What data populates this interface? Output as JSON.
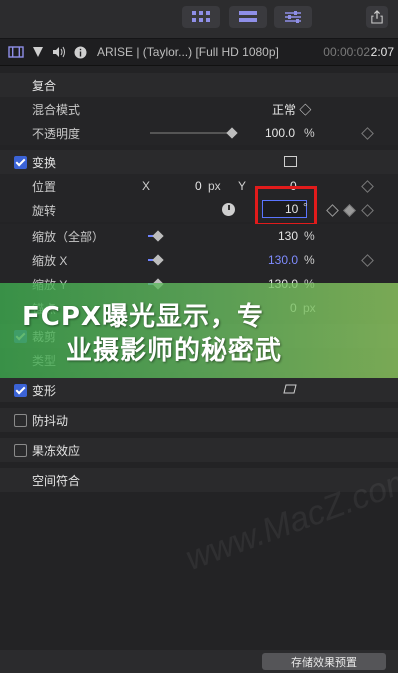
{
  "inspector": {
    "clip_name": "ARISE | (Taylor...) [Full HD 1080p]",
    "timecode": "00:00:02",
    "duration": "2:07"
  },
  "rows": {
    "composite": "复合",
    "blend_mode": "混合模式",
    "blend_mode_value": "正常 ◇",
    "opacity": "不透明度",
    "opacity_value": "100.0",
    "opacity_unit": "%",
    "transform": "变换",
    "position": "位置",
    "x_label": "X",
    "pos_x_value": "0",
    "pos_unit": "px",
    "y_label": "Y",
    "pos_y_value": "0",
    "rotation": "旋转",
    "rotation_value": "10",
    "rotation_unit": "°",
    "scale_all": "缩放（全部）",
    "scale_all_value": "130",
    "scale_all_unit": "%",
    "scale_x": "缩放 X",
    "scale_x_value": "130.0",
    "scale_x_unit": "%",
    "scale_y": "缩放 Y",
    "scale_y_value": "130.0",
    "scale_y_unit": "%",
    "anchor": "锚点",
    "anchor_value": "0",
    "anchor_unit": "px",
    "crop": "裁剪",
    "type": "类型",
    "distort": "变形",
    "stabilize": "防抖动",
    "rolling_shutter": "果冻效应",
    "spatial_conform": "空间符合"
  },
  "banner": {
    "line1": "FCPX曝光显示，专",
    "line2": "业摄影师的秘密武"
  },
  "watermark": "www.MacZ.com",
  "footer": {
    "save_preset": "存储效果预置"
  }
}
